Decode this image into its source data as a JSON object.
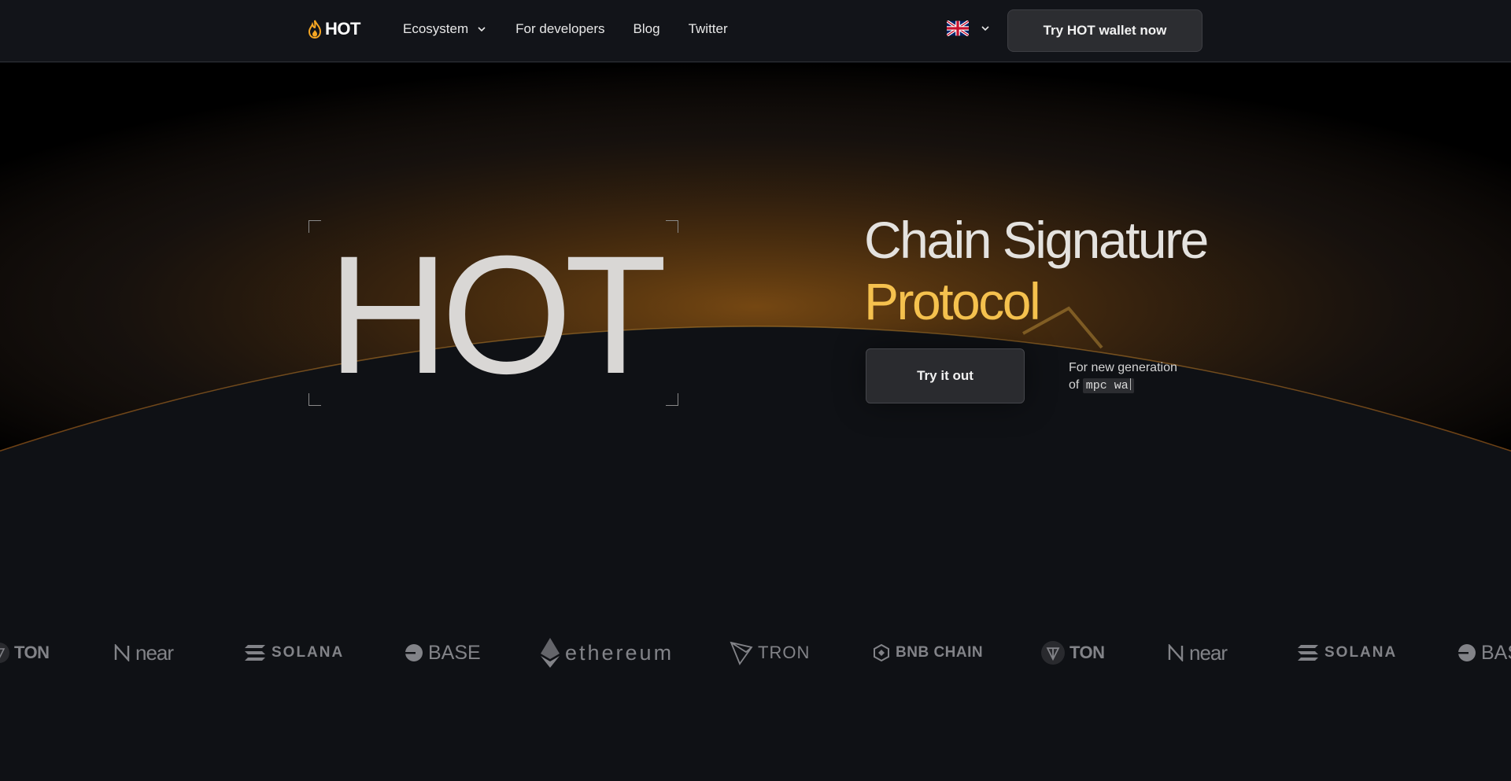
{
  "nav": {
    "logo": "HOT",
    "links": [
      {
        "label": "Ecosystem",
        "has_dropdown": true
      },
      {
        "label": "For developers"
      },
      {
        "label": "Blog"
      },
      {
        "label": "Twitter"
      }
    ],
    "language_flag": "uk-flag-icon",
    "cta": "Try HOT wallet now"
  },
  "hero": {
    "big_title": "HOT",
    "headline_line1": "Chain Signature",
    "headline_line2": "Protocol",
    "try_button": "Try it out",
    "tagline_prefix": "For new generation",
    "tagline_of": "of",
    "typed_text": "mpc wa"
  },
  "chains": {
    "ton": "TON",
    "near": "near",
    "solana": "SOLANA",
    "base": "BASE",
    "ethereum": "ethereum",
    "tron": "TRON",
    "bnb": "BNB CHAIN"
  },
  "colors": {
    "accent": "#f5c14e",
    "background": "#0f1115",
    "nav_bg": "#121419",
    "glow": "#e39a2a"
  }
}
